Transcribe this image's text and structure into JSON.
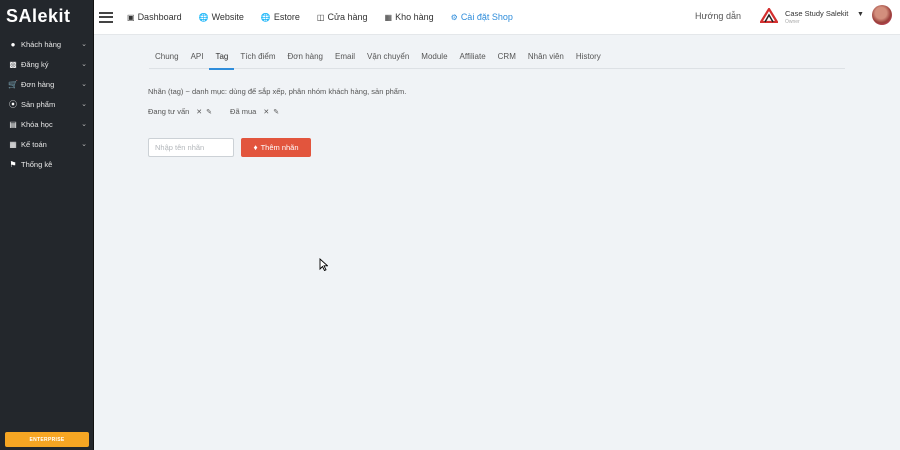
{
  "brand": {
    "name": "SAlekit"
  },
  "sidebar": {
    "items": [
      {
        "label": "Khách hàng",
        "icon": "person-icon"
      },
      {
        "label": "Đăng ký",
        "icon": "card-icon"
      },
      {
        "label": "Đơn hàng",
        "icon": "cart-icon"
      },
      {
        "label": "Sản phẩm",
        "icon": "circle-icon"
      },
      {
        "label": "Khóa học",
        "icon": "book-icon"
      },
      {
        "label": "Kế toán",
        "icon": "calculator-icon"
      },
      {
        "label": "Thống kê",
        "icon": "flag-icon"
      }
    ],
    "enterprise_label": "ENTERPRISE"
  },
  "topnav": {
    "items": [
      {
        "label": "Dashboard",
        "icon": "monitor-icon"
      },
      {
        "label": "Website",
        "icon": "globe-icon"
      },
      {
        "label": "Estore",
        "icon": "globe-icon"
      },
      {
        "label": "Cửa hàng",
        "icon": "store-icon"
      },
      {
        "label": "Kho hàng",
        "icon": "boxes-icon"
      },
      {
        "label": "Cài đặt Shop",
        "icon": "gear-icon"
      }
    ],
    "help": "Hướng dẫn",
    "company": "Case Study Salekit",
    "role": "Owner"
  },
  "tabs": [
    "Chung",
    "API",
    "Tag",
    "Tích điểm",
    "Đơn hàng",
    "Email",
    "Vận chuyển",
    "Module",
    "Affiliate",
    "CRM",
    "Nhân viên",
    "History"
  ],
  "tag_section": {
    "description": "Nhãn (tag) ~ danh mục: dùng để sắp xếp, phân nhóm khách hàng, sản phẩm.",
    "tags": [
      "Đang tư vấn",
      "Đã mua"
    ],
    "input_placeholder": "Nhập tên nhãn",
    "add_button": "Thêm nhãn"
  },
  "colors": {
    "accent": "#2f8ddb",
    "danger": "#e2553d",
    "sidebar_bg": "#23272c",
    "enterprise": "#f6a623"
  }
}
